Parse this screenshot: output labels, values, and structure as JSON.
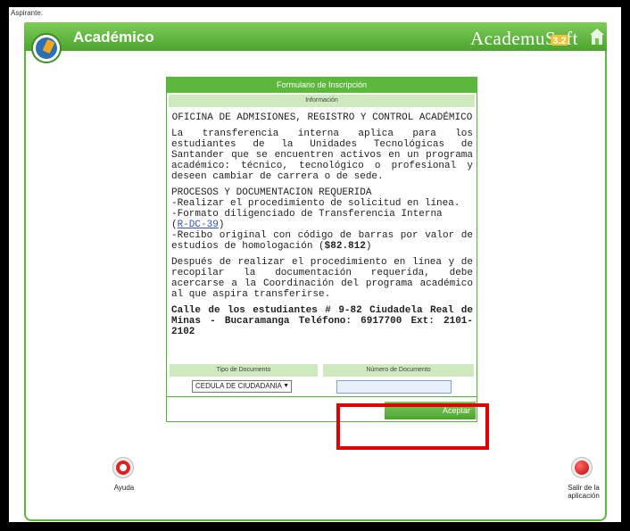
{
  "window": {
    "user_label": "Aspirante."
  },
  "header": {
    "app_title": "Académico",
    "brand_main": "Academu",
    "brand_soft": "Soft",
    "brand_version": "3.2"
  },
  "form": {
    "title": "Formulario de Inscripción",
    "subtitle": "Información",
    "heading": "OFICINA DE ADMISIONES, REGISTRO Y CONTROL ACADÉMICO",
    "paragraph1": "La transferencia interna aplica para los estudiantes de la Unidades Tecnológicas de Santander que se encuentren activos en un programa académico: técnico, tecnológico o profesional y deseen cambiar de carrera o de sede.",
    "process_title": "PROCESOS Y DOCUMENTACION REQUERIDA",
    "process_line1": "-Realizar el procedimiento de solicitud en línea.",
    "process_line2": "-Formato diligenciado de Transferencia Interna",
    "process_link": "R-DC-39",
    "process_line3_a": "-Recibo original con código de barras por valor de estudios de homologación (",
    "process_amount": "$82.812",
    "process_line3_b": ")",
    "paragraph3": "Después de realizar el procedimiento en línea y de recopilar la documentación requerida, debe acercarse a la Coordinación del programa académico al que aspira transferirse.",
    "address": "Calle de los estudiantes # 9-82 Ciudadela Real de Minas - Bucaramanga Teléfono: 6917700 Ext: 2101-2102",
    "doc_type_label": "Tipo de Documento",
    "doc_number_label": "Número de Documento",
    "doc_type_value": "CEDULA DE CIUDADANIA",
    "doc_number_value": "",
    "accept_label": "Aceptar"
  },
  "footer": {
    "help_label": "Ayuda",
    "exit_label_line1": "Salir de la",
    "exit_label_line2": "aplicación"
  },
  "colors": {
    "green": "#5bb83d",
    "light_green": "#cfe9bf",
    "highlight_red": "#e10000",
    "link_blue": "#3355bb"
  },
  "icons": [
    "lifebuoy-icon",
    "exit-icon",
    "home-icon",
    "academico-logo-icon"
  ]
}
